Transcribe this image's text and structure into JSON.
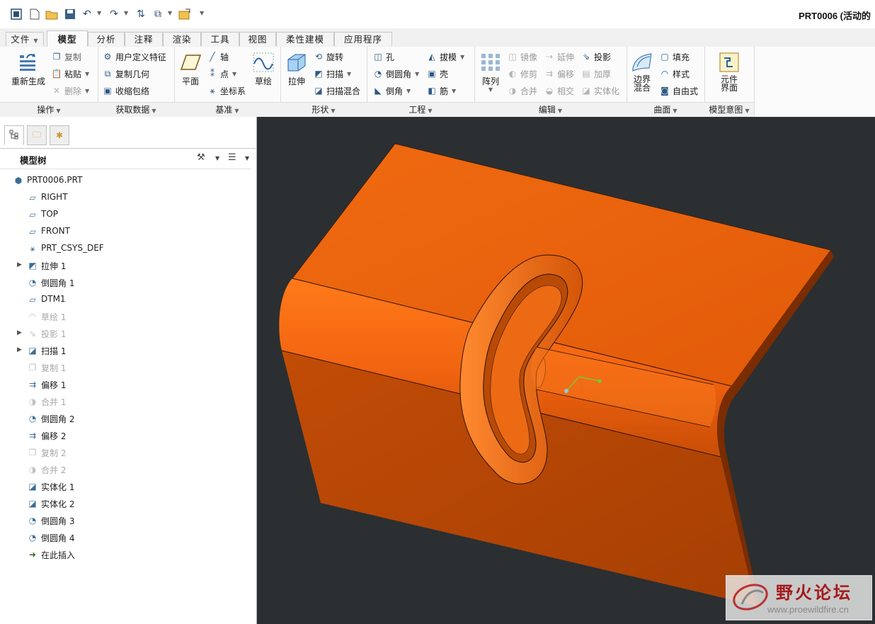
{
  "window": {
    "title": "PRT0006 (活动的"
  },
  "tabs": [
    "文件",
    "模型",
    "分析",
    "注释",
    "渲染",
    "工具",
    "视图",
    "柔性建模",
    "应用程序"
  ],
  "ribbon": {
    "operations": {
      "label": "操作",
      "regenerate": "重新生成",
      "copy": "复制",
      "paste": "粘贴",
      "delete": "删除"
    },
    "get_data": {
      "label": "获取数据",
      "udf": "用户定义特征",
      "copy_geom": "复制几何",
      "shrinkwrap": "收缩包络"
    },
    "datum": {
      "label": "基准",
      "plane": "平面",
      "axis": "轴",
      "point": "点",
      "csys": "坐标系",
      "sketch": "草绘"
    },
    "shapes": {
      "label": "形状",
      "extrude": "拉伸",
      "revolve": "旋转",
      "sweep": "扫描",
      "swept_blend": "扫描混合"
    },
    "engineering": {
      "label": "工程",
      "hole": "孔",
      "round": "倒圆角",
      "chamfer": "倒角",
      "draft": "拔模",
      "shell": "壳",
      "rib": "筋"
    },
    "editing": {
      "label": "编辑",
      "pattern": "阵列",
      "mirror": "镜像",
      "extend": "延伸",
      "project": "投影",
      "trim": "修剪",
      "offset": "偏移",
      "thicken": "加厚",
      "merge": "合并",
      "intersect": "相交",
      "solidify": "实体化"
    },
    "surfaces": {
      "label": "曲面",
      "boundary_blend_1": "边界",
      "boundary_blend_2": "混合",
      "fill": "填充",
      "style": "样式",
      "freestyle": "自由式"
    },
    "model_intent": {
      "label": "模型意图",
      "component_1": "元件",
      "component_2": "界面"
    }
  },
  "tree": {
    "title": "模型树",
    "nodes": [
      {
        "label": "PRT0006.PRT",
        "icon": "part-icon",
        "expandable": false,
        "suppressed": false
      },
      {
        "label": "RIGHT",
        "icon": "datum-plane-icon",
        "expandable": false,
        "suppressed": false
      },
      {
        "label": "TOP",
        "icon": "datum-plane-icon",
        "expandable": false,
        "suppressed": false
      },
      {
        "label": "FRONT",
        "icon": "datum-plane-icon",
        "expandable": false,
        "suppressed": false
      },
      {
        "label": "PRT_CSYS_DEF",
        "icon": "csys-icon",
        "expandable": false,
        "suppressed": false
      },
      {
        "label": "拉伸 1",
        "icon": "extrude-icon",
        "expandable": true,
        "suppressed": false
      },
      {
        "label": "倒圆角 1",
        "icon": "round-icon",
        "expandable": false,
        "suppressed": false
      },
      {
        "label": "DTM1",
        "icon": "datum-plane-icon",
        "expandable": false,
        "suppressed": false
      },
      {
        "label": "草绘 1",
        "icon": "sketch-icon",
        "expandable": false,
        "suppressed": true
      },
      {
        "label": "投影 1",
        "icon": "project-icon",
        "expandable": true,
        "suppressed": true
      },
      {
        "label": "扫描 1",
        "icon": "sweep-icon",
        "expandable": true,
        "suppressed": false
      },
      {
        "label": "复制 1",
        "icon": "copy-icon",
        "expandable": false,
        "suppressed": true
      },
      {
        "label": "偏移 1",
        "icon": "offset-icon",
        "expandable": false,
        "suppressed": false
      },
      {
        "label": "合并 1",
        "icon": "merge-icon",
        "expandable": false,
        "suppressed": true
      },
      {
        "label": "倒圆角 2",
        "icon": "round-icon",
        "expandable": false,
        "suppressed": false
      },
      {
        "label": "偏移 2",
        "icon": "offset-icon",
        "expandable": false,
        "suppressed": false
      },
      {
        "label": "复制 2",
        "icon": "copy-icon",
        "expandable": false,
        "suppressed": true
      },
      {
        "label": "合并 2",
        "icon": "merge-icon",
        "expandable": false,
        "suppressed": true
      },
      {
        "label": "实体化 1",
        "icon": "solidify-icon",
        "expandable": false,
        "suppressed": false
      },
      {
        "label": "实体化 2",
        "icon": "solidify-icon",
        "expandable": false,
        "suppressed": false
      },
      {
        "label": "倒圆角 3",
        "icon": "round-icon",
        "expandable": false,
        "suppressed": false
      },
      {
        "label": "倒圆角 4",
        "icon": "round-icon",
        "expandable": false,
        "suppressed": false
      },
      {
        "label": "在此插入",
        "icon": "insert-here-icon",
        "expandable": false,
        "suppressed": false
      }
    ]
  },
  "colors": {
    "model": "#e85d0a",
    "model_dark": "#a83f05",
    "viewport_bg": "#2b2f31"
  },
  "watermark": {
    "text": "野火论坛",
    "url": "www.proewildfire.cn"
  }
}
